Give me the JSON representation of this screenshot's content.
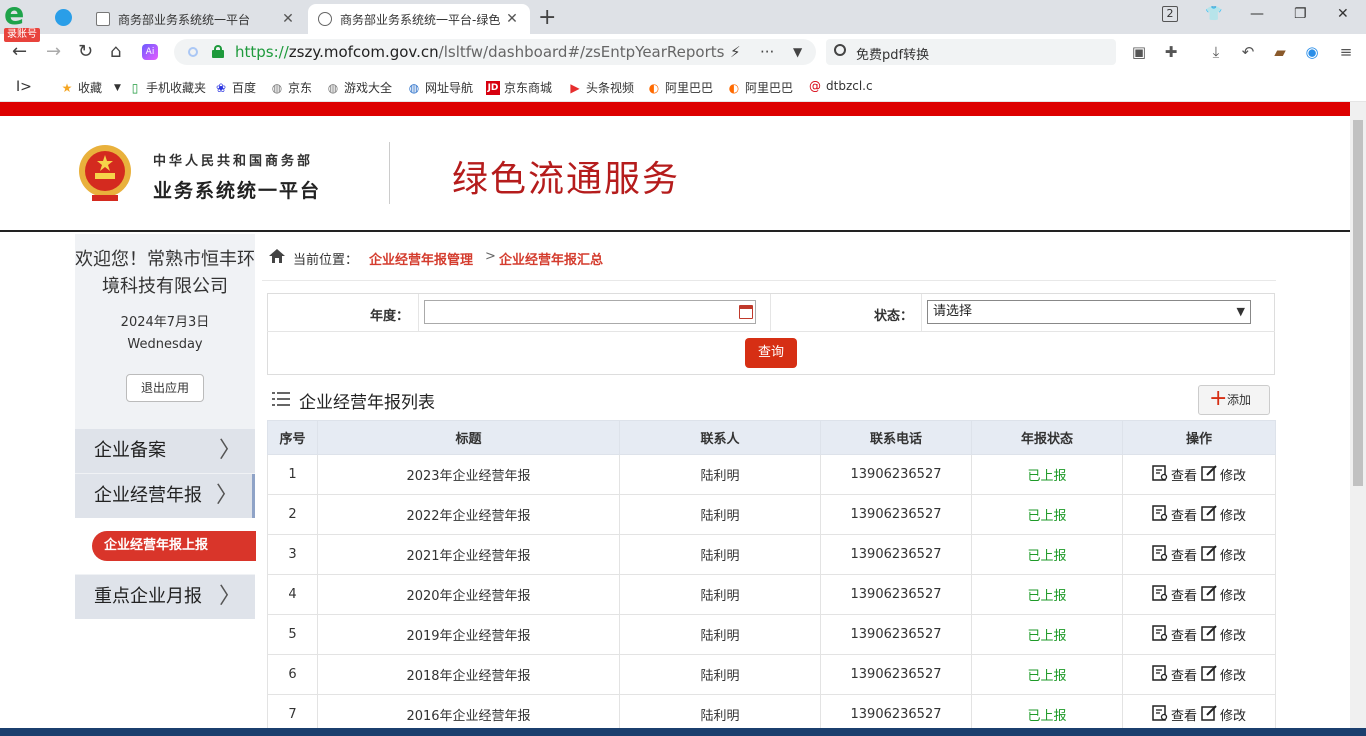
{
  "browser": {
    "login_badge": "录账号",
    "tabs": [
      {
        "title": "商务部业务系统统一平台"
      },
      {
        "title": "商务部业务系统统一平台-绿色"
      }
    ],
    "url_https": "https://",
    "url_host": "zszy.mofcom.gov.cn",
    "url_path": "/lsltfw/dashboard#/zsEntpYearReports",
    "search_text": "免费pdf转换",
    "tab_count": "2",
    "bookmarks": [
      "收藏",
      "手机收藏夹",
      "百度",
      "京东",
      "游戏大全",
      "网址导航",
      "京东商城",
      "头条视频",
      "阿里巴巴",
      "阿里巴巴",
      "dtbzcl.c"
    ]
  },
  "header": {
    "org_line1": "中华人民共和国商务部",
    "org_line2": "业务系统统一平台",
    "service_title": "绿色流通服务"
  },
  "sidebar": {
    "welcome": "欢迎您！常熟市恒丰环境科技有限公司",
    "date": "2024年7月3日",
    "weekday": "Wednesday",
    "logout": "退出应用",
    "menu": [
      {
        "label": "企业备案"
      },
      {
        "label": "企业经营年报"
      },
      {
        "label": "重点企业月报"
      }
    ],
    "submenu_active": "企业经营年报上报"
  },
  "breadcrumb": {
    "label": "当前位置：",
    "level1": "企业经营年报管理",
    "sep": ">",
    "level2": "企业经营年报汇总"
  },
  "filter": {
    "year_label": "年度：",
    "year_value": "",
    "status_label": "状态：",
    "status_value": "请选择",
    "query_button": "查询"
  },
  "list": {
    "title": "企业经营年报列表",
    "add_button": "添加",
    "columns": [
      "序号",
      "标题",
      "联系人",
      "联系电话",
      "年报状态",
      "操作"
    ],
    "view_label": "查看",
    "edit_label": "修改",
    "rows": [
      {
        "no": "1",
        "title": "2023年企业经营年报",
        "contact": "陆利明",
        "phone": "13906236527",
        "status": "已上报"
      },
      {
        "no": "2",
        "title": "2022年企业经营年报",
        "contact": "陆利明",
        "phone": "13906236527",
        "status": "已上报"
      },
      {
        "no": "3",
        "title": "2021年企业经营年报",
        "contact": "陆利明",
        "phone": "13906236527",
        "status": "已上报"
      },
      {
        "no": "4",
        "title": "2020年企业经营年报",
        "contact": "陆利明",
        "phone": "13906236527",
        "status": "已上报"
      },
      {
        "no": "5",
        "title": "2019年企业经营年报",
        "contact": "陆利明",
        "phone": "13906236527",
        "status": "已上报"
      },
      {
        "no": "6",
        "title": "2018年企业经营年报",
        "contact": "陆利明",
        "phone": "13906236527",
        "status": "已上报"
      },
      {
        "no": "7",
        "title": "2016年企业经营年报",
        "contact": "陆利明",
        "phone": "13906236527",
        "status": "已上报"
      }
    ]
  },
  "colors": {
    "brand_red": "#dd0000",
    "title_red": "#b51c1c",
    "accent": "#d62f14",
    "status_green": "#1e9a28"
  }
}
